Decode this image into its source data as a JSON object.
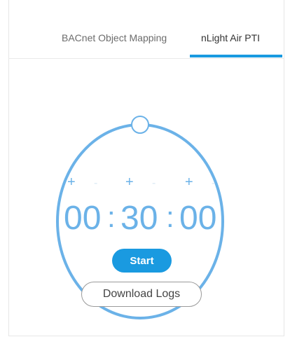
{
  "tabs": [
    {
      "label": "BACnet Object Mapping",
      "active": false
    },
    {
      "label": "nLight Air PTI",
      "active": true
    }
  ],
  "timer": {
    "hours": "00",
    "minutes": "30",
    "seconds": "00",
    "separator": ":",
    "plus_symbol": "+",
    "minus_symbol": "-"
  },
  "buttons": {
    "start_label": "Start",
    "download_label": "Download Logs"
  },
  "colors": {
    "accent": "#1a9ae0",
    "dial": "#6bb2e8"
  }
}
